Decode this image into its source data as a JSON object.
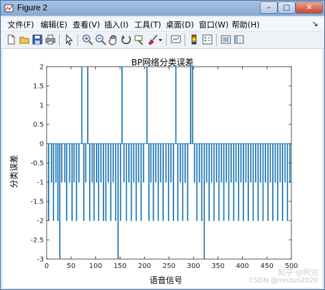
{
  "window": {
    "title": "Figure 2"
  },
  "menu": [
    {
      "label": "文件(F)"
    },
    {
      "label": "编辑(E)"
    },
    {
      "label": "查看(V)"
    },
    {
      "label": "插入(I)"
    },
    {
      "label": "工具(T)"
    },
    {
      "label": "桌面(D)"
    },
    {
      "label": "窗口(W)"
    },
    {
      "label": "帮助(H)"
    }
  ],
  "toolbar": {
    "icons": [
      "new-figure-icon",
      "open-file-icon",
      "save-icon",
      "print-icon",
      "pointer-icon",
      "zoom-in-icon",
      "zoom-out-icon",
      "pan-icon",
      "rotate-icon",
      "data-cursor-icon",
      "brush-icon",
      "link-plot-icon",
      "colorbar-icon",
      "legend-icon",
      "plot-tools-hide-icon",
      "plot-tools-show-icon"
    ]
  },
  "plot": {
    "title": "BP网络分类误差",
    "xlabel": "语音信号",
    "ylabel": "分类误差"
  },
  "watermark": {
    "line1": "知乎 @阿泊",
    "line2": "CSDN @mozun2020"
  },
  "colors": {
    "line": "#1f77b4",
    "axes": "#262626"
  },
  "chart_data": {
    "type": "line",
    "title": "BP网络分类误差",
    "xlabel": "语音信号",
    "ylabel": "分类误差",
    "xlim": [
      0,
      500
    ],
    "ylim": [
      -3,
      2
    ],
    "xticks": [
      0,
      50,
      100,
      150,
      200,
      250,
      300,
      350,
      400,
      450,
      500
    ],
    "yticks": [
      2,
      1.5,
      1,
      0.5,
      0,
      -0.5,
      -1,
      -1.5,
      -2,
      -2.5,
      -3
    ],
    "baseline": 0,
    "spikes": [
      {
        "x": 4,
        "y": -2
      },
      {
        "x": 10,
        "y": -1
      },
      {
        "x": 14,
        "y": -2
      },
      {
        "x": 19,
        "y": -1
      },
      {
        "x": 23,
        "y": -2
      },
      {
        "x": 27,
        "y": -3
      },
      {
        "x": 31,
        "y": -1
      },
      {
        "x": 37,
        "y": -1
      },
      {
        "x": 41,
        "y": -2
      },
      {
        "x": 47,
        "y": -1
      },
      {
        "x": 52,
        "y": -2
      },
      {
        "x": 56,
        "y": -1
      },
      {
        "x": 61,
        "y": -2
      },
      {
        "x": 66,
        "y": -1
      },
      {
        "x": 72,
        "y": 2
      },
      {
        "x": 76,
        "y": -2
      },
      {
        "x": 80,
        "y": -1
      },
      {
        "x": 84,
        "y": 2
      },
      {
        "x": 88,
        "y": -2
      },
      {
        "x": 93,
        "y": -1
      },
      {
        "x": 97,
        "y": -2
      },
      {
        "x": 102,
        "y": -1
      },
      {
        "x": 106,
        "y": -2
      },
      {
        "x": 111,
        "y": -1
      },
      {
        "x": 116,
        "y": -2
      },
      {
        "x": 121,
        "y": -2
      },
      {
        "x": 126,
        "y": -1
      },
      {
        "x": 131,
        "y": -2
      },
      {
        "x": 136,
        "y": -1
      },
      {
        "x": 141,
        "y": -2
      },
      {
        "x": 146,
        "y": -3
      },
      {
        "x": 151,
        "y": -2
      },
      {
        "x": 154,
        "y": 2
      },
      {
        "x": 158,
        "y": -1
      },
      {
        "x": 163,
        "y": -2
      },
      {
        "x": 168,
        "y": -1
      },
      {
        "x": 173,
        "y": -2
      },
      {
        "x": 178,
        "y": -1
      },
      {
        "x": 183,
        "y": -2
      },
      {
        "x": 188,
        "y": -1
      },
      {
        "x": 193,
        "y": -2
      },
      {
        "x": 198,
        "y": -1
      },
      {
        "x": 205,
        "y": 2
      },
      {
        "x": 209,
        "y": -2
      },
      {
        "x": 213,
        "y": -1
      },
      {
        "x": 218,
        "y": -2
      },
      {
        "x": 223,
        "y": -1
      },
      {
        "x": 228,
        "y": -2
      },
      {
        "x": 233,
        "y": -1
      },
      {
        "x": 238,
        "y": -2
      },
      {
        "x": 244,
        "y": -1
      },
      {
        "x": 249,
        "y": -2
      },
      {
        "x": 254,
        "y": -1
      },
      {
        "x": 259,
        "y": -2
      },
      {
        "x": 264,
        "y": 2
      },
      {
        "x": 268,
        "y": -2
      },
      {
        "x": 273,
        "y": -1
      },
      {
        "x": 278,
        "y": -2
      },
      {
        "x": 283,
        "y": -1
      },
      {
        "x": 288,
        "y": -2
      },
      {
        "x": 294,
        "y": 2
      },
      {
        "x": 298,
        "y": 2
      },
      {
        "x": 302,
        "y": -1
      },
      {
        "x": 307,
        "y": -2
      },
      {
        "x": 312,
        "y": -1
      },
      {
        "x": 317,
        "y": -2
      },
      {
        "x": 322,
        "y": -3
      },
      {
        "x": 327,
        "y": -1
      },
      {
        "x": 332,
        "y": -2
      },
      {
        "x": 337,
        "y": -1
      },
      {
        "x": 342,
        "y": -2
      },
      {
        "x": 347,
        "y": -1
      },
      {
        "x": 352,
        "y": -2
      },
      {
        "x": 357,
        "y": -1
      },
      {
        "x": 362,
        "y": -2
      },
      {
        "x": 367,
        "y": -1
      },
      {
        "x": 372,
        "y": -2
      },
      {
        "x": 377,
        "y": -1
      },
      {
        "x": 382,
        "y": -2
      },
      {
        "x": 387,
        "y": -1
      },
      {
        "x": 392,
        "y": -2
      },
      {
        "x": 397,
        "y": -1
      },
      {
        "x": 402,
        "y": -2
      },
      {
        "x": 407,
        "y": -1
      },
      {
        "x": 412,
        "y": -2
      },
      {
        "x": 417,
        "y": -1
      },
      {
        "x": 422,
        "y": -2
      },
      {
        "x": 427,
        "y": -1
      },
      {
        "x": 432,
        "y": -2
      },
      {
        "x": 437,
        "y": -1
      },
      {
        "x": 442,
        "y": -2
      },
      {
        "x": 447,
        "y": -1
      },
      {
        "x": 452,
        "y": -2
      },
      {
        "x": 457,
        "y": -1
      },
      {
        "x": 462,
        "y": -2
      },
      {
        "x": 467,
        "y": -1
      },
      {
        "x": 472,
        "y": -2
      },
      {
        "x": 477,
        "y": -1
      },
      {
        "x": 482,
        "y": -2
      },
      {
        "x": 487,
        "y": -1
      },
      {
        "x": 492,
        "y": -2
      },
      {
        "x": 497,
        "y": -1
      }
    ]
  }
}
